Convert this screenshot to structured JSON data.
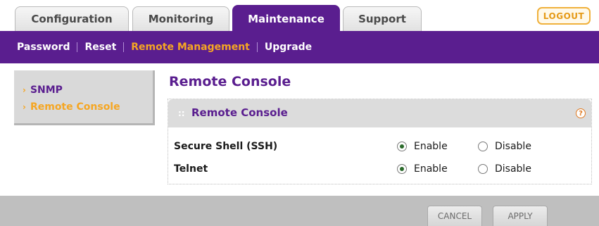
{
  "tabs": [
    {
      "label": "Configuration",
      "active": false
    },
    {
      "label": "Monitoring",
      "active": false
    },
    {
      "label": "Maintenance",
      "active": true
    },
    {
      "label": "Support",
      "active": false
    }
  ],
  "logout_label": "LOGOUT",
  "subnav": [
    {
      "label": "Password",
      "active": false
    },
    {
      "label": "Reset",
      "active": false
    },
    {
      "label": "Remote Management",
      "active": true
    },
    {
      "label": "Upgrade",
      "active": false
    }
  ],
  "sidebar": [
    {
      "label": "SNMP",
      "active": false
    },
    {
      "label": "Remote Console",
      "active": true
    }
  ],
  "page_title": "Remote Console",
  "panel": {
    "title": "Remote Console",
    "help_glyph": "?",
    "rows": [
      {
        "label": "Secure Shell (SSH)",
        "enable_label": "Enable",
        "disable_label": "Disable",
        "selected": "Enable"
      },
      {
        "label": "Telnet",
        "enable_label": "Enable",
        "disable_label": "Disable",
        "selected": "Enable"
      }
    ]
  },
  "buttons": {
    "cancel": "CANCEL",
    "apply": "APPLY"
  },
  "colors": {
    "brand_purple": "#5a1e8f",
    "accent_orange": "#f5a623",
    "footer_gray": "#bfbfbf"
  },
  "icons": {
    "help": "help-icon",
    "arrow": "chevron-right-icon",
    "grip": "drag-grip-icon"
  }
}
